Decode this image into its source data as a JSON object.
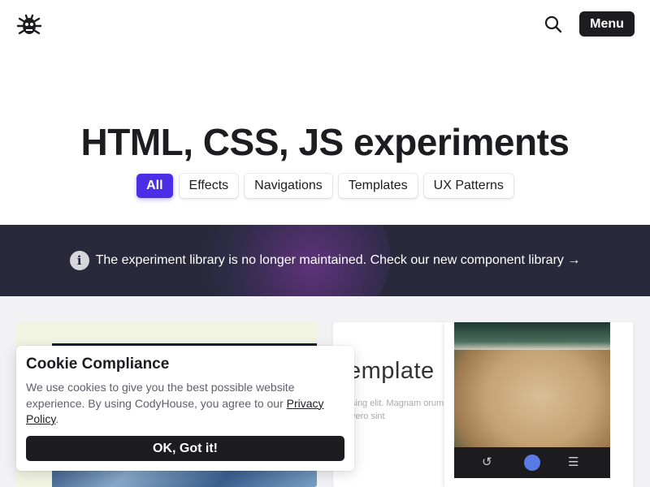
{
  "header": {
    "logo_icon": "bug-icon",
    "search_icon": "search-icon",
    "menu_label": "Menu"
  },
  "hero": {
    "title": "HTML, CSS, JS experiments",
    "filters": [
      {
        "label": "All",
        "active": true
      },
      {
        "label": "Effects",
        "active": false
      },
      {
        "label": "Navigations",
        "active": false
      },
      {
        "label": "Templates",
        "active": false
      },
      {
        "label": "UX Patterns",
        "active": false
      }
    ]
  },
  "banner": {
    "icon": "info-icon",
    "text": "The experiment library is no longer maintained. Check our new component library →"
  },
  "gallery": {
    "card2": {
      "title": "emplate",
      "subtitle": "sing elit. Magnam orum vero sint"
    }
  },
  "cookie": {
    "title": "Cookie Compliance",
    "text_before": "We use cookies to give you the best possible website experience. By using CodyHouse, you agree to our ",
    "link": "Privacy Policy",
    "text_after": ".",
    "button": "OK, Got it!"
  },
  "colors": {
    "accent": "#4c2ee6",
    "dark": "#1c1c21",
    "banner_bg": "#282a3b"
  }
}
